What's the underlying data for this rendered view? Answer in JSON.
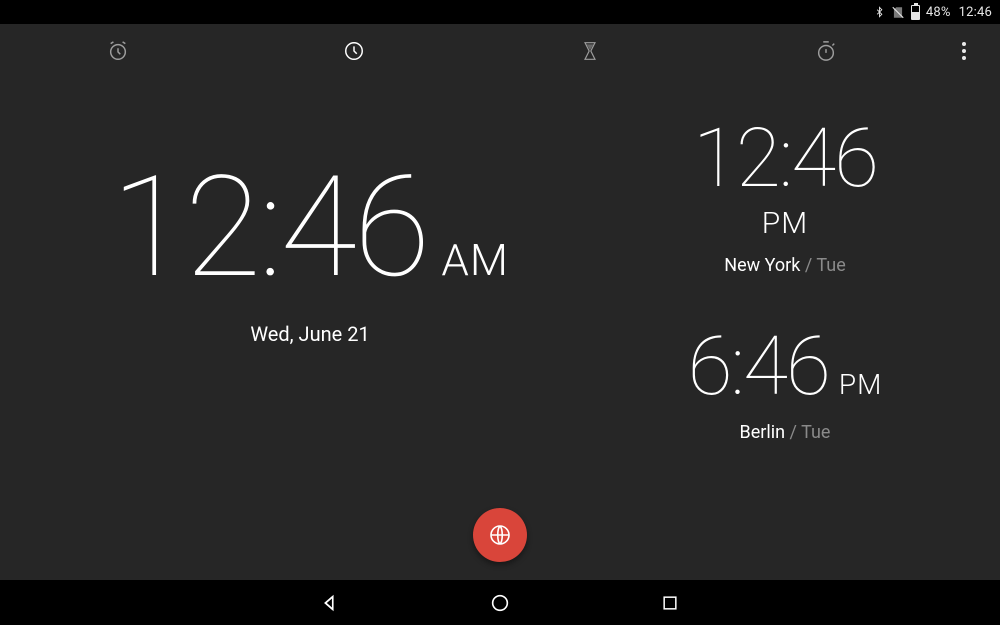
{
  "status": {
    "battery_pct": "48%",
    "time": "12:46"
  },
  "tabs": {
    "alarm": "Alarm",
    "clock": "Clock",
    "timer": "Timer",
    "stopwatch": "Stopwatch"
  },
  "local": {
    "time": "12:46",
    "ampm": "AM",
    "date": "Wed, June 21"
  },
  "world": [
    {
      "time": "12:46",
      "ampm": "PM",
      "city": "New York",
      "day": "Tue"
    },
    {
      "time": "6:46",
      "ampm": "PM",
      "city": "Berlin",
      "day": "Tue"
    }
  ],
  "colors": {
    "accent": "#d9453a"
  }
}
